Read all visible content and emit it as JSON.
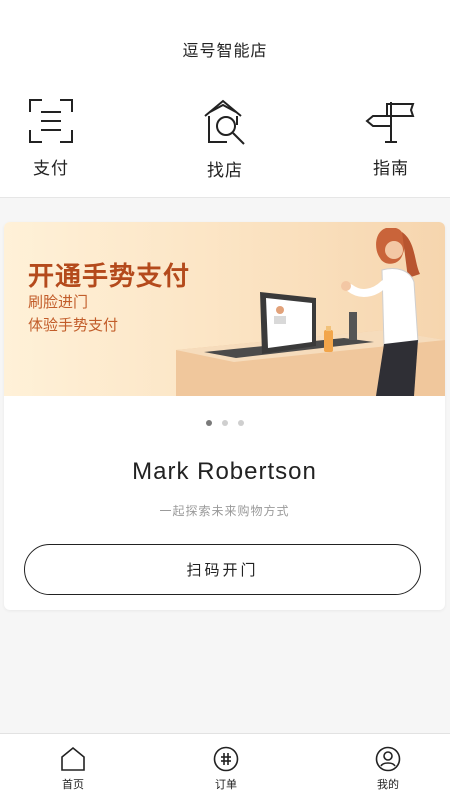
{
  "header": {
    "title": "逗号智能店"
  },
  "quick_actions": [
    {
      "label": "支付",
      "icon": "scan-frame-icon"
    },
    {
      "label": "找店",
      "icon": "store-search-icon"
    },
    {
      "label": "指南",
      "icon": "signpost-icon"
    }
  ],
  "banner": {
    "title": "开通手势支付",
    "lines": [
      "刷脸进门",
      "体验手势支付"
    ],
    "slides": 3,
    "active_slide": 1
  },
  "user": {
    "name": "Mark Robertson",
    "slogan": "一起探索未来购物方式"
  },
  "actions": {
    "scan_open": "扫码开门"
  },
  "tabbar": [
    {
      "label": "首页",
      "icon": "home-icon"
    },
    {
      "label": "订单",
      "icon": "order-hash-icon"
    },
    {
      "label": "我的",
      "icon": "user-icon"
    }
  ],
  "colors": {
    "banner_title": "#b44a1c",
    "banner_text": "#c25d2a",
    "dot_active": "#7a7a7a",
    "dot_inactive": "#cfcfcf"
  }
}
